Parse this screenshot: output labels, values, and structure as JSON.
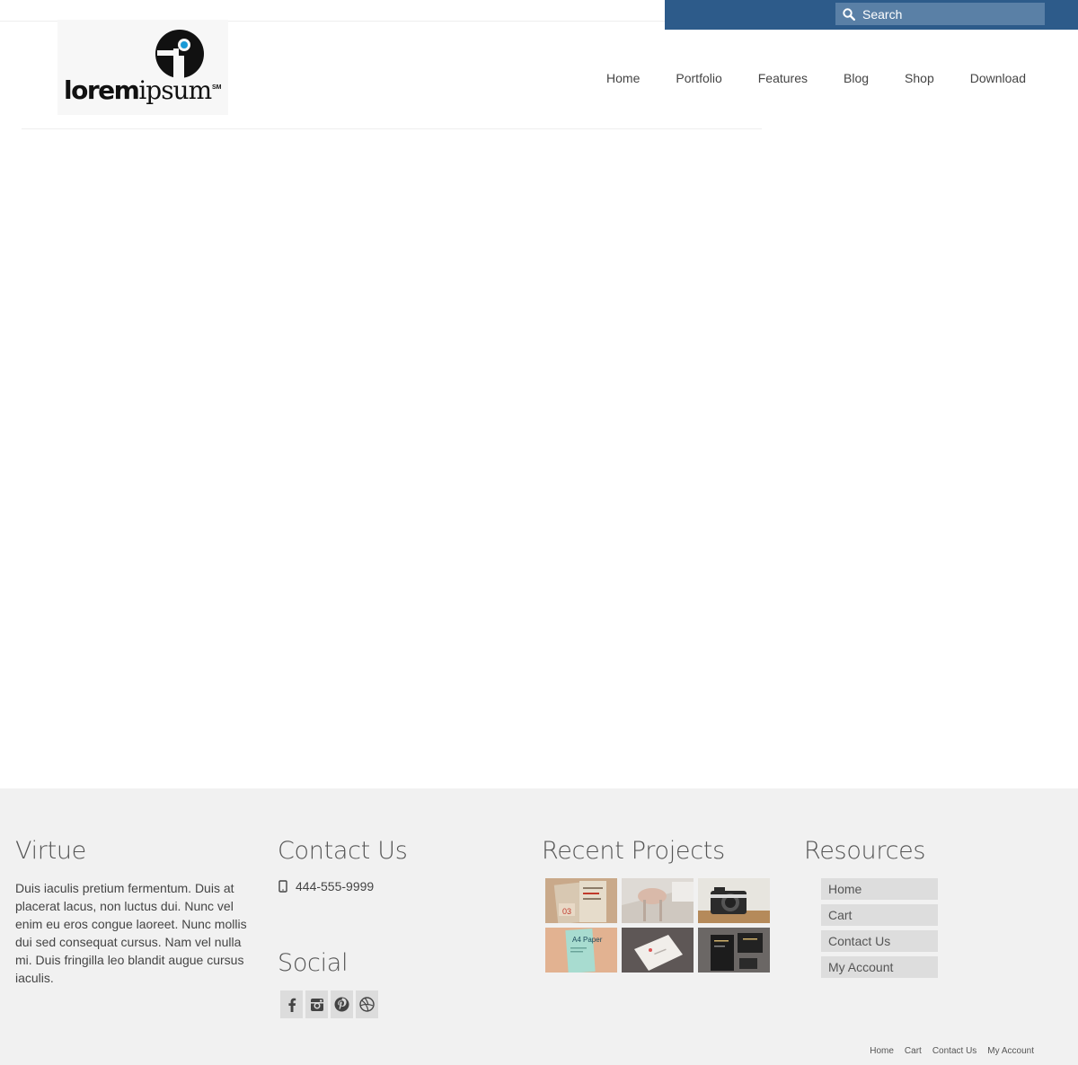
{
  "search": {
    "placeholder": "Search",
    "icon": "search-icon"
  },
  "logo": {
    "text_bold": "lorem",
    "text_regular": "ipsum",
    "tm": "SM"
  },
  "nav": {
    "items": [
      {
        "label": "Home"
      },
      {
        "label": "Portfolio"
      },
      {
        "label": "Features"
      },
      {
        "label": "Blog"
      },
      {
        "label": "Shop"
      },
      {
        "label": "Download"
      }
    ]
  },
  "footer": {
    "about": {
      "title": "Virtue",
      "text": "Duis iaculis pretium fermentum. Duis at placerat lacus, non luctus dui. Nunc vel enim eu eros congue laoreet. Nunc mollis dui sed consequat cursus. Nam vel nulla mi. Duis fringilla leo blandit augue cursus iaculis."
    },
    "contact": {
      "title": "Contact Us",
      "phone": "444-555-9999",
      "phone_icon": "mobile-phone-icon"
    },
    "social": {
      "title": "Social",
      "icons": [
        "facebook-icon",
        "instagram-icon",
        "pinterest-icon",
        "dribbble-icon"
      ]
    },
    "projects": {
      "title": "Recent Projects",
      "thumbs": [
        {
          "label": "03"
        },
        {
          "label": ""
        },
        {
          "label": ""
        },
        {
          "label": "A4 Paper"
        },
        {
          "label": ""
        },
        {
          "label": ""
        }
      ]
    },
    "resources": {
      "title": "Resources",
      "items": [
        {
          "label": "Home"
        },
        {
          "label": "Cart"
        },
        {
          "label": "Contact Us"
        },
        {
          "label": "My Account"
        }
      ]
    },
    "bottom_links": [
      {
        "label": "Home"
      },
      {
        "label": "Cart"
      },
      {
        "label": "Contact Us"
      },
      {
        "label": "My Account"
      }
    ]
  },
  "colors": {
    "topbar": "#2d5b8a",
    "search_field": "#5a80a6",
    "footer_bg": "#f1f1f1"
  }
}
